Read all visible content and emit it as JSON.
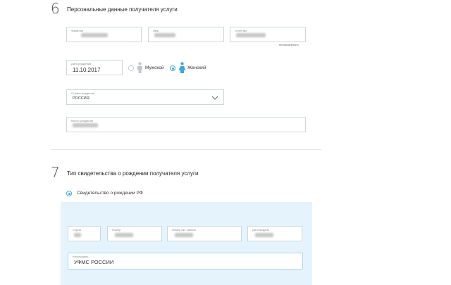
{
  "section6": {
    "number": "6",
    "title": "Персональные данные получателя услуги",
    "surname_label": "Фамилия",
    "name_label": "Имя",
    "patronymic_label": "Отчество",
    "optional_note": "необязательно",
    "birthdate_label": "Дата рождения",
    "birthdate_value": "11.10.2017",
    "gender_male": "Мужской",
    "gender_female": "Женский",
    "country_label": "Страна рождения",
    "country_value": "РОССИЯ",
    "birthplace_label": "Место рождения"
  },
  "section7": {
    "number": "7",
    "title": "Тип свидетельства о рождении получателя услуги",
    "option_rf": "Свидетельство о рождении РФ",
    "series_label": "Серия",
    "number_label": "Номер",
    "record_label": "Номер акт. записи",
    "issue_date_label": "Дата выдачи",
    "issued_by_label": "Кем выдано",
    "issued_by_value": "УФМС РОССИИ"
  },
  "colors": {
    "accent": "#3fa7d9",
    "panel": "#e5f3fc",
    "border": "#cfd6dc"
  },
  "icons": {
    "male": "male-person-icon",
    "female": "female-person-icon",
    "dropdown": "chevron-down-icon"
  }
}
